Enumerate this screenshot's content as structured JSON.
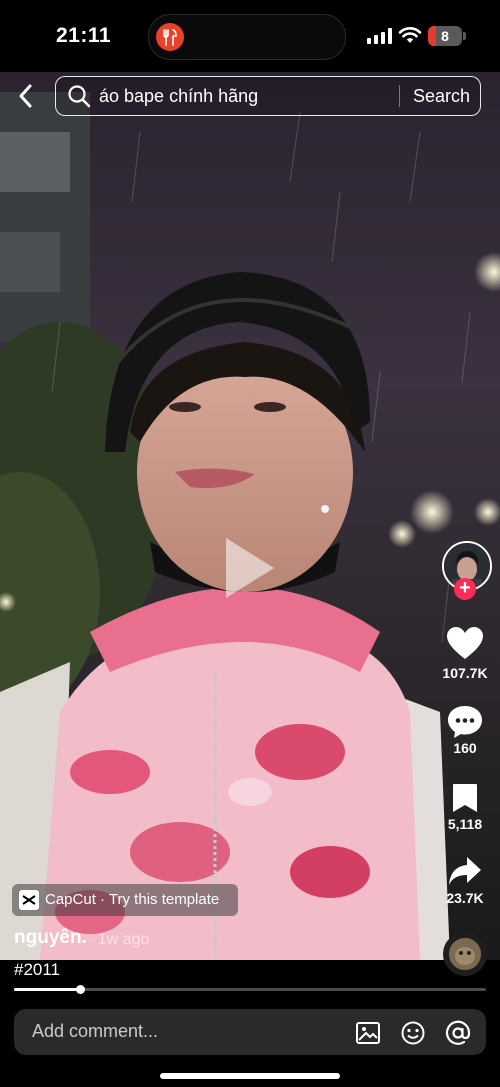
{
  "status_bar": {
    "time": "21:11",
    "battery": "8",
    "battery_level": 0.08,
    "island_app_icon": "food-app-icon"
  },
  "search": {
    "back_icon": "chevron-left-icon",
    "query": "áo bape chính hãng",
    "button_label": "Search",
    "icon": "search-icon"
  },
  "video": {
    "play_icon": "play-icon",
    "progress": 0.14
  },
  "rail": {
    "likes": "107.7K",
    "comments": "160",
    "saves": "5,118",
    "shares": "23.7K",
    "follow_icon": "plus-icon"
  },
  "post": {
    "template_label": "CapCut · Try this template",
    "username": "nguyên.",
    "posted": "· 1w ago",
    "caption": "#2011"
  },
  "comment_bar": {
    "placeholder": "Add comment...",
    "icons": [
      "image-icon",
      "emoji-icon",
      "mention-icon"
    ]
  },
  "colors": {
    "accent": "#fe2c55",
    "battery_low": "#e23b30"
  }
}
